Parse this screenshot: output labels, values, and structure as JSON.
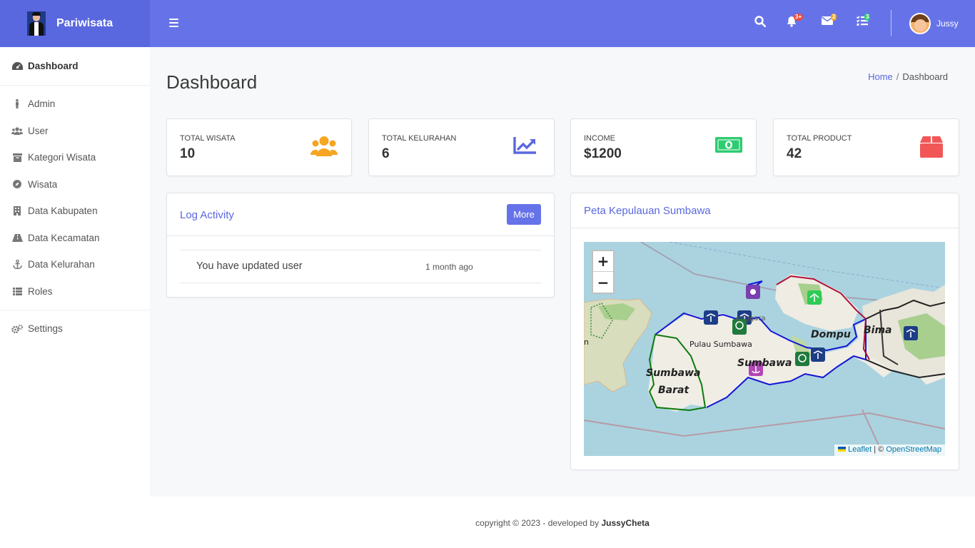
{
  "brand": {
    "name": "Pariwisata"
  },
  "sidebar": {
    "items": [
      {
        "label": "Dashboard",
        "icon": "tachometer-icon"
      },
      {
        "label": "Admin",
        "icon": "person-icon"
      },
      {
        "label": "User",
        "icon": "users-icon"
      },
      {
        "label": "Kategori Wisata",
        "icon": "archive-icon"
      },
      {
        "label": "Wisata",
        "icon": "compass-icon"
      },
      {
        "label": "Data Kabupaten",
        "icon": "building-icon"
      },
      {
        "label": "Data Kecamatan",
        "icon": "road-icon"
      },
      {
        "label": "Data Kelurahan",
        "icon": "anchor-icon"
      },
      {
        "label": "Roles",
        "icon": "list-icon"
      },
      {
        "label": "Settings",
        "icon": "cogs-icon"
      }
    ]
  },
  "topbar": {
    "notifications_badge": "3+",
    "messages_badge": "2",
    "tasks_badge": "3",
    "user_name": "Jussy"
  },
  "page": {
    "title": "Dashboard",
    "breadcrumb": {
      "home": "Home",
      "separator": "/",
      "current": "Dashboard"
    }
  },
  "stats": [
    {
      "label": "TOTAL WISATA",
      "value": "10",
      "icon": "users-icon",
      "color": "#f6a623"
    },
    {
      "label": "TOTAL KELURAHAN",
      "value": "6",
      "icon": "chart-line-icon",
      "color": "#5a68df"
    },
    {
      "label": "INCOME",
      "value": "$1200",
      "icon": "money-bill-icon",
      "color": "#2ecc71"
    },
    {
      "label": "TOTAL PRODUCT",
      "value": "42",
      "icon": "box-icon",
      "color": "#f25757"
    }
  ],
  "log": {
    "title": "Log Activity",
    "more_label": "More",
    "entries": [
      {
        "text": "You have updated user",
        "time": "1 month ago"
      }
    ]
  },
  "map": {
    "title": "Peta Kepulauan Sumbawa",
    "zoom_in": "+",
    "zoom_out": "−",
    "labels": {
      "sumbawa_barat_1": "Sumbawa",
      "sumbawa_barat_2": "Barat",
      "pulau_sumbawa": "Pulau Sumbawa",
      "sumbawa": "Sumbawa",
      "dompu": "Dompu",
      "bima": "Bima",
      "tenggara": "enggara",
      "left_edge": "n"
    },
    "attribution": {
      "leaflet": "Leaflet",
      "separator": "| ©",
      "osm": "OpenStreetMap"
    }
  },
  "footer": {
    "text": "copyright © 2023 - developed by",
    "author": "JussyCheta"
  }
}
